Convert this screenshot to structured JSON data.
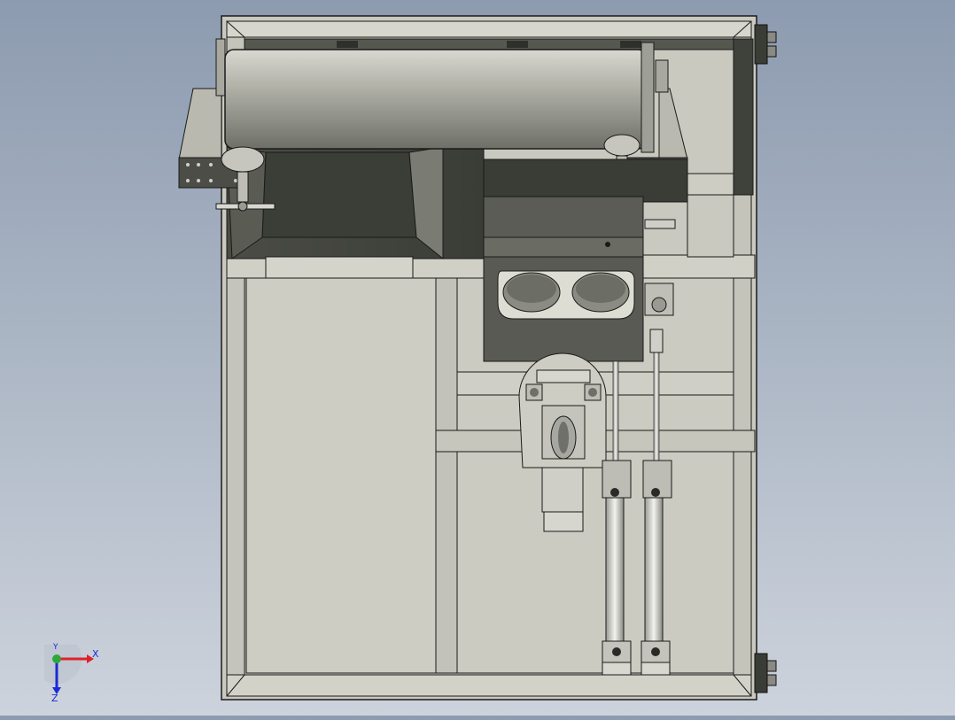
{
  "scene": {
    "name": "cad-assembly-top-view",
    "colors": {
      "background_top": "#8d9bb0",
      "background_bottom": "#cdd3dc",
      "frame_face": "#c8c8be",
      "frame_dark": "#3c3e38",
      "drum": "#b8b8b0",
      "edge": "#1a1a1a"
    }
  },
  "triad": {
    "x_label": "X",
    "y_label": "Y",
    "z_label": "Z",
    "x_color": "#e0202a",
    "y_color": "#2aa83a",
    "z_color": "#1a2bd6"
  }
}
